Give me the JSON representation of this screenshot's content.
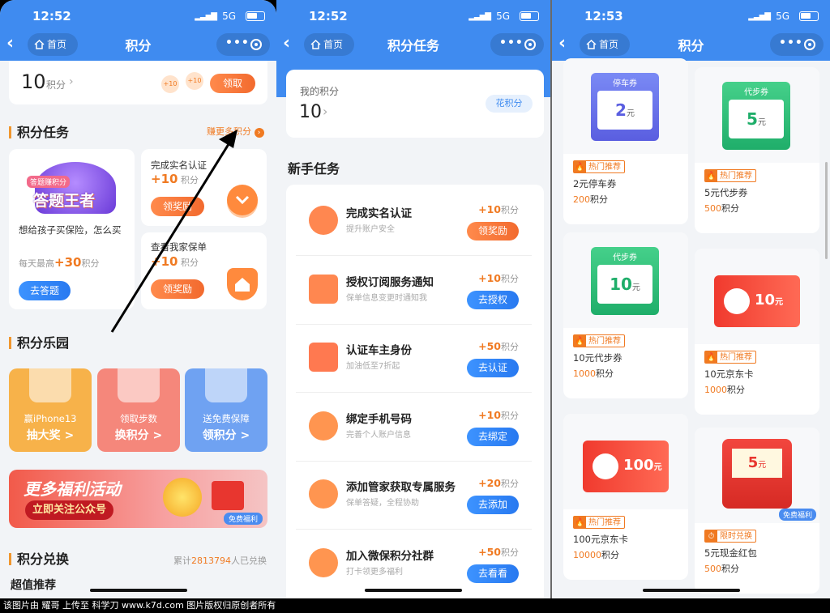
{
  "status": {
    "time1": "12:52",
    "time2": "12:52",
    "time3": "12:53",
    "network": "5G"
  },
  "nav": {
    "home": "首页",
    "title1": "积分",
    "title2": "积分任务",
    "title3": "积分"
  },
  "p1": {
    "points": "10",
    "points_unit": "积分",
    "bubble1": "+10",
    "bubble2": "+10",
    "claim_btn": "领取",
    "tasks_title": "积分任务",
    "earn_more": "赚更多积分",
    "quiz_badge": "答题赚积分",
    "quiz_brand": "答题王者",
    "quiz_question": "想给孩子买保险，怎么买",
    "quiz_daily_prefix": "每天最高",
    "quiz_daily_num": "+30",
    "quiz_daily_unit": "积分",
    "quiz_btn": "去答题",
    "task1_title": "完成实名认证",
    "task1_pts": "+10",
    "task1_unit": "积分",
    "task1_btn": "领奖励",
    "task2_title": "查看我家保单",
    "task2_pts": "+10",
    "task2_unit": "积分",
    "task2_btn": "领奖励",
    "park_title": "积分乐园",
    "games": [
      {
        "line1": "赢iPhone13",
        "line2": "抽大奖 >",
        "color": "#f7b24a"
      },
      {
        "line1": "领取步数",
        "line2": "换积分 >",
        "color": "#f5877b"
      },
      {
        "line1": "送免费保障",
        "line2": "领积分 >",
        "color": "#6fa2f2"
      }
    ],
    "banner_title": "更多福利活动",
    "banner_btn": "立即关注公众号",
    "banner_tag": "免费福利",
    "exchange_title": "积分兑换",
    "exchange_count_prefix": "累计",
    "exchange_count": "2813794",
    "exchange_count_suffix": "人已兑换",
    "recommend_title": "超值推荐"
  },
  "p2": {
    "my_points_label": "我的积分",
    "my_points": "10",
    "spend_btn": "花积分",
    "new_tasks_title": "新手任务",
    "tasks": [
      {
        "title": "完成实名认证",
        "desc": "提升账户安全",
        "pts": "+10",
        "unit": "积分",
        "btn": "领奖励",
        "style": "orange",
        "icon": "medal-icon"
      },
      {
        "title": "授权订阅服务通知",
        "desc": "保单信息变更时通知我",
        "pts": "+10",
        "unit": "积分",
        "btn": "去授权",
        "style": "blue",
        "icon": "envelope-icon"
      },
      {
        "title": "认证车主身份",
        "desc": "加油低至7折起",
        "pts": "+50",
        "unit": "积分",
        "btn": "去认证",
        "style": "blue",
        "icon": "car-icon"
      },
      {
        "title": "绑定手机号码",
        "desc": "完善个人账户信息",
        "pts": "+10",
        "unit": "积分",
        "btn": "去绑定",
        "style": "blue",
        "icon": "phone-icon"
      },
      {
        "title": "添加管家获取专属服务",
        "desc": "保单答疑，全程协助",
        "pts": "+20",
        "unit": "积分",
        "btn": "去添加",
        "style": "blue",
        "icon": "shield-heart-icon"
      },
      {
        "title": "加入微保积分社群",
        "desc": "打卡领更多福利",
        "pts": "+50",
        "unit": "积分",
        "btn": "去看看",
        "style": "blue",
        "icon": "chat-icon"
      }
    ]
  },
  "p3": {
    "items": [
      {
        "label": "停车券",
        "value": "2",
        "unit": "元",
        "tag": "热门推荐",
        "name": "2元停车券",
        "price": "200",
        "price_unit": "积分",
        "kind": "ticket-blue"
      },
      {
        "label": "代步券",
        "value": "5",
        "unit": "元",
        "tag": "热门推荐",
        "name": "5元代步券",
        "price": "500",
        "price_unit": "积分",
        "kind": "ticket-green"
      },
      {
        "label": "代步券",
        "value": "10",
        "unit": "元",
        "tag": "热门推荐",
        "name": "10元代步券",
        "price": "1000",
        "price_unit": "积分",
        "kind": "ticket-green"
      },
      {
        "label": "",
        "value": "10",
        "unit": "元",
        "tag": "热门推荐",
        "name": "10元京东卡",
        "price": "1000",
        "price_unit": "积分",
        "kind": "jd-card"
      },
      {
        "label": "",
        "value": "100",
        "unit": "元",
        "tag": "热门推荐",
        "name": "100元京东卡",
        "price": "10000",
        "price_unit": "积分",
        "kind": "jd-card"
      },
      {
        "label": "免费福利",
        "value": "5",
        "unit": "元",
        "tag": "限时兑换",
        "name": "5元现金红包",
        "price": "500",
        "price_unit": "积分",
        "kind": "red-packet"
      }
    ]
  },
  "footer": "该图片由 耀哥 上传至 科学刀 www.k7d.com 图片版权归原创者所有",
  "colors": {
    "header_blue": "#3f8bf0",
    "accent_orange": "#f07a22",
    "button_blue": "#2879f0"
  }
}
